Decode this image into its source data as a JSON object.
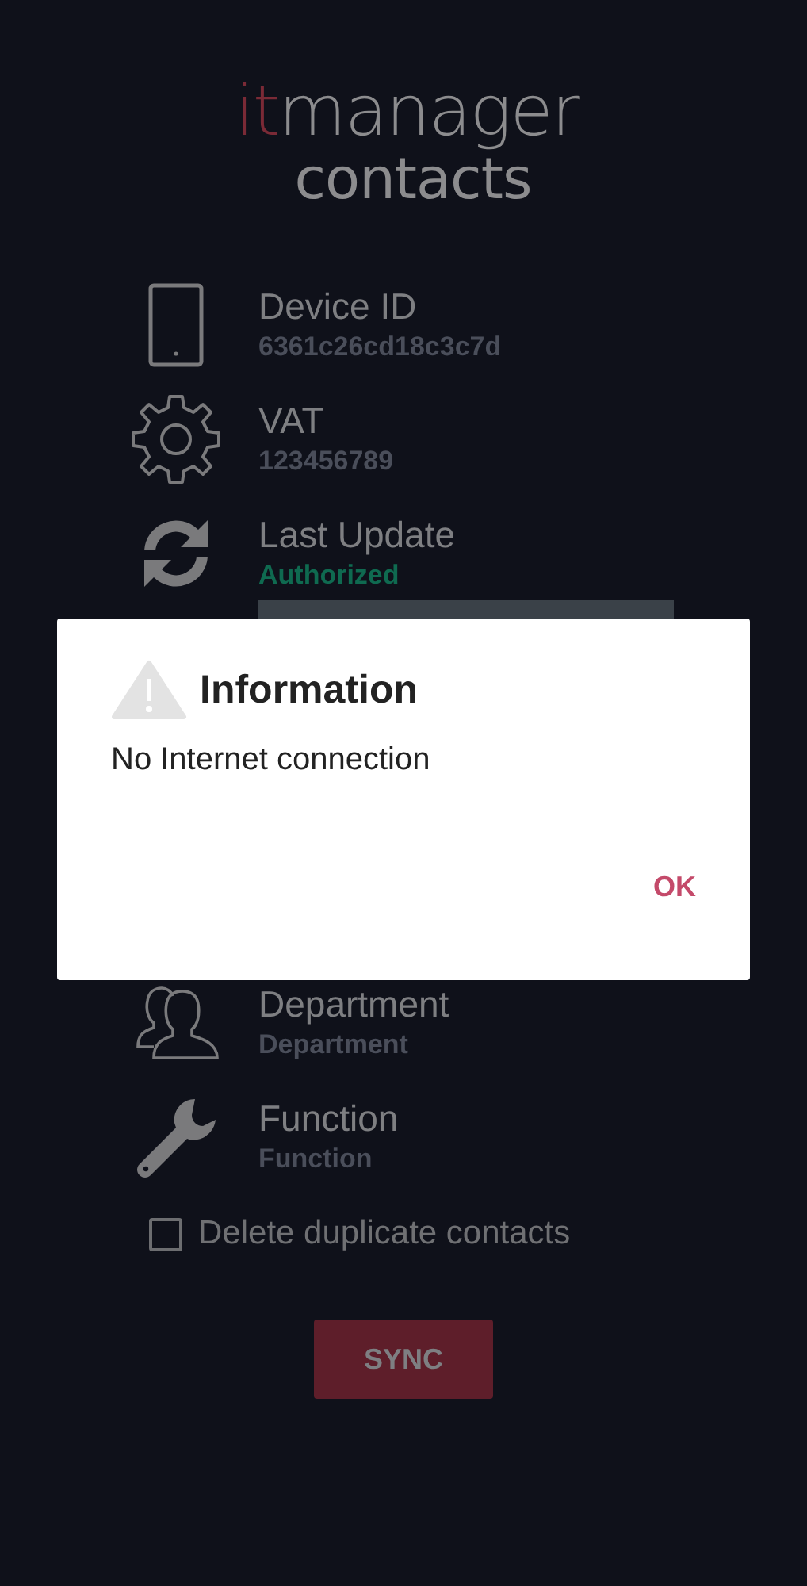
{
  "logo": {
    "line_1": [
      {
        "text": "it",
        "color": "#7a2a36"
      },
      {
        "text": "manager",
        "color": "#8c8c8e"
      }
    ],
    "line_2": "contacts"
  },
  "fields_top": [
    {
      "kind": "phone",
      "label": "Device ID",
      "value": "6361c26cd18c3c7d",
      "highlighted": false
    },
    {
      "kind": "gear",
      "label": "VAT",
      "value": "123456789",
      "highlighted": false
    },
    {
      "kind": "sync",
      "label": "Last Update",
      "value": "Authorized",
      "highlighted": true
    }
  ],
  "fields_bottom": [
    {
      "kind": "people",
      "label": "Department",
      "value": "Department",
      "highlighted": false
    },
    {
      "kind": "wrench",
      "label": "Function",
      "value": "Function",
      "highlighted": false
    }
  ],
  "checkbox": {
    "label": "Delete duplicate contacts",
    "checked": false
  },
  "sync_button": "SYNC",
  "dialog": {
    "title": "Information",
    "message": "No Internet connection",
    "button": "OK"
  }
}
